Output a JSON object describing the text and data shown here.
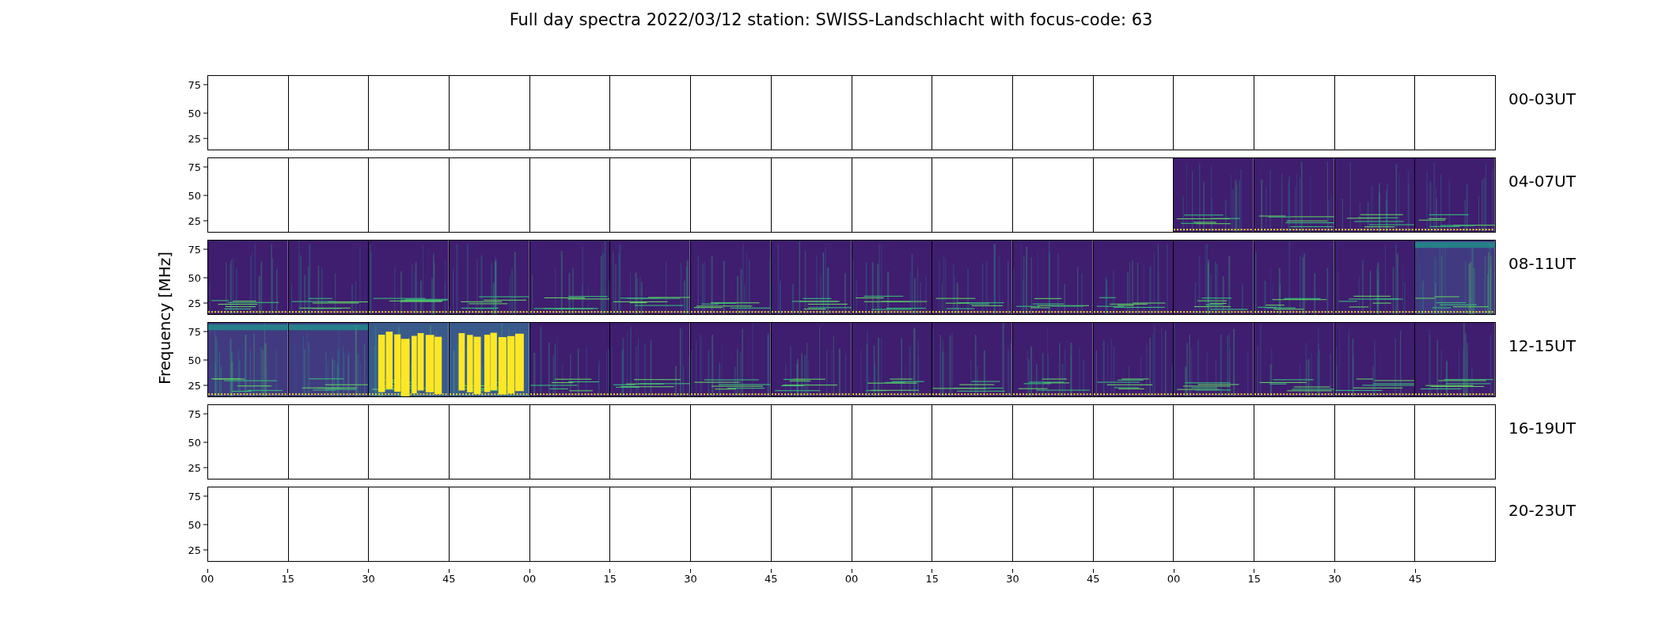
{
  "title": "Full day spectra 2022/03/12 station: SWISS-Landschlacht with focus-code: 63",
  "ylabel": "Frequency [MHz]",
  "xticks": [
    "00",
    "15",
    "30",
    "45",
    "00",
    "15",
    "30",
    "45",
    "00",
    "15",
    "30",
    "45",
    "00",
    "15",
    "30",
    "45"
  ],
  "rows": [
    {
      "label": "00-03UT",
      "yticks": [
        "75",
        "50",
        "25"
      ],
      "panels": [
        {
          "kind": "empty"
        },
        {
          "kind": "empty"
        },
        {
          "kind": "empty"
        },
        {
          "kind": "empty"
        },
        {
          "kind": "empty"
        },
        {
          "kind": "empty"
        },
        {
          "kind": "empty"
        },
        {
          "kind": "empty"
        },
        {
          "kind": "empty"
        },
        {
          "kind": "empty"
        },
        {
          "kind": "empty"
        },
        {
          "kind": "empty"
        },
        {
          "kind": "empty"
        },
        {
          "kind": "empty"
        },
        {
          "kind": "empty"
        },
        {
          "kind": "empty"
        }
      ]
    },
    {
      "label": "04-07UT",
      "yticks": [
        "75",
        "50",
        "25"
      ],
      "panels": [
        {
          "kind": "empty"
        },
        {
          "kind": "empty"
        },
        {
          "kind": "empty"
        },
        {
          "kind": "empty"
        },
        {
          "kind": "empty"
        },
        {
          "kind": "empty"
        },
        {
          "kind": "empty"
        },
        {
          "kind": "empty"
        },
        {
          "kind": "empty"
        },
        {
          "kind": "empty"
        },
        {
          "kind": "empty"
        },
        {
          "kind": "empty"
        },
        {
          "kind": "spectrum"
        },
        {
          "kind": "spectrum"
        },
        {
          "kind": "spectrum"
        },
        {
          "kind": "spectrum"
        }
      ]
    },
    {
      "label": "08-11UT",
      "yticks": [
        "75",
        "50",
        "25"
      ],
      "panels": [
        {
          "kind": "spectrum"
        },
        {
          "kind": "spectrum"
        },
        {
          "kind": "spectrum"
        },
        {
          "kind": "spectrum"
        },
        {
          "kind": "spectrum"
        },
        {
          "kind": "spectrum"
        },
        {
          "kind": "spectrum"
        },
        {
          "kind": "spectrum"
        },
        {
          "kind": "spectrum"
        },
        {
          "kind": "spectrum"
        },
        {
          "kind": "spectrum"
        },
        {
          "kind": "spectrum"
        },
        {
          "kind": "spectrum"
        },
        {
          "kind": "spectrum"
        },
        {
          "kind": "spectrum"
        },
        {
          "kind": "active"
        }
      ]
    },
    {
      "label": "12-15UT",
      "yticks": [
        "75",
        "50",
        "25"
      ],
      "panels": [
        {
          "kind": "active"
        },
        {
          "kind": "active"
        },
        {
          "kind": "burst"
        },
        {
          "kind": "burst"
        },
        {
          "kind": "spectrum"
        },
        {
          "kind": "spectrum"
        },
        {
          "kind": "spectrum"
        },
        {
          "kind": "spectrum"
        },
        {
          "kind": "spectrum"
        },
        {
          "kind": "spectrum"
        },
        {
          "kind": "spectrum"
        },
        {
          "kind": "spectrum"
        },
        {
          "kind": "spectrum"
        },
        {
          "kind": "spectrum"
        },
        {
          "kind": "spectrum"
        },
        {
          "kind": "spectrum"
        }
      ]
    },
    {
      "label": "16-19UT",
      "yticks": [
        "75",
        "50",
        "25"
      ],
      "panels": [
        {
          "kind": "empty"
        },
        {
          "kind": "empty"
        },
        {
          "kind": "empty"
        },
        {
          "kind": "empty"
        },
        {
          "kind": "empty"
        },
        {
          "kind": "empty"
        },
        {
          "kind": "empty"
        },
        {
          "kind": "empty"
        },
        {
          "kind": "empty"
        },
        {
          "kind": "empty"
        },
        {
          "kind": "empty"
        },
        {
          "kind": "empty"
        },
        {
          "kind": "empty"
        },
        {
          "kind": "empty"
        },
        {
          "kind": "empty"
        },
        {
          "kind": "empty"
        }
      ]
    },
    {
      "label": "20-23UT",
      "yticks": [
        "75",
        "50",
        "25"
      ],
      "panels": [
        {
          "kind": "empty"
        },
        {
          "kind": "empty"
        },
        {
          "kind": "empty"
        },
        {
          "kind": "empty"
        },
        {
          "kind": "empty"
        },
        {
          "kind": "empty"
        },
        {
          "kind": "empty"
        },
        {
          "kind": "empty"
        },
        {
          "kind": "empty"
        },
        {
          "kind": "empty"
        },
        {
          "kind": "empty"
        },
        {
          "kind": "empty"
        },
        {
          "kind": "empty"
        },
        {
          "kind": "empty"
        },
        {
          "kind": "empty"
        },
        {
          "kind": "empty"
        }
      ]
    }
  ]
}
